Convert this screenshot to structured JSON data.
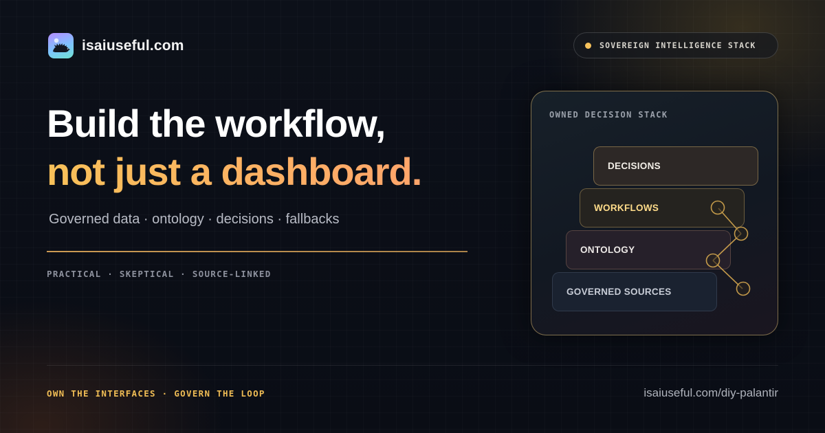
{
  "brand": {
    "name": "isaiuseful.com",
    "logo_icon": "hedgehog-icon"
  },
  "badge": {
    "label": "SOVEREIGN INTELLIGENCE STACK",
    "dot_color": "#f6c25c"
  },
  "hero": {
    "line1": "Build the workflow,",
    "line2": "not just a dashboard.",
    "subtitle": "Governed data · ontology · decisions · fallbacks",
    "tags": "PRACTICAL · SKEPTICAL · SOURCE-LINKED"
  },
  "stack": {
    "title": "OWNED DECISION STACK",
    "layers": [
      {
        "label": "DECISIONS"
      },
      {
        "label": "WORKFLOWS"
      },
      {
        "label": "ONTOLOGY"
      },
      {
        "label": "GOVERNED SOURCES"
      }
    ]
  },
  "footer": {
    "tagline": "OWN THE INTERFACES · GOVERN THE LOOP",
    "url": "isaiuseful.com/diy-palantir"
  },
  "colors": {
    "accent_gold": "#f0bd55",
    "accent_orange": "#ffa56b",
    "background": "#0b0f18"
  }
}
